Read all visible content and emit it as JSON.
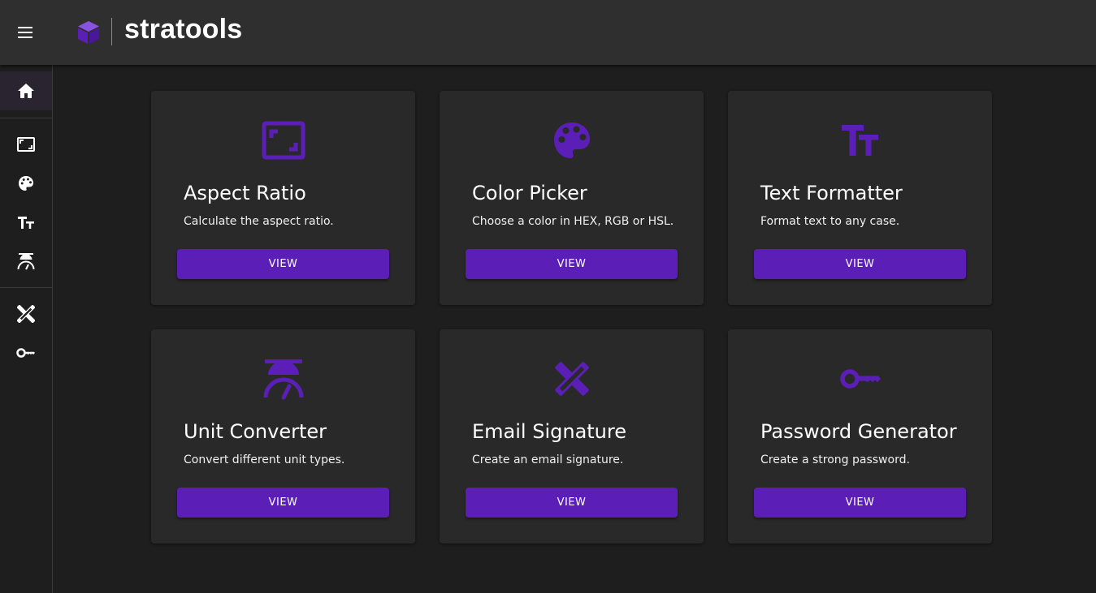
{
  "app": {
    "brand": "stratools",
    "accent_color": "#5b1fb7",
    "icon_color": "#5b1fb7"
  },
  "sidebar": {
    "items": [
      {
        "icon": "home-icon",
        "active": true
      },
      {
        "icon": "aspect-ratio-icon"
      },
      {
        "icon": "palette-icon"
      },
      {
        "icon": "text-fields-icon"
      },
      {
        "icon": "scale-icon"
      },
      {
        "icon": "design-services-icon"
      },
      {
        "icon": "key-icon"
      }
    ]
  },
  "cards": [
    {
      "icon": "aspect-ratio-icon",
      "title": "Aspect Ratio",
      "description": "Calculate the aspect ratio.",
      "button": "VIEW"
    },
    {
      "icon": "palette-icon",
      "title": "Color Picker",
      "description": "Choose a color in HEX, RGB or HSL.",
      "button": "VIEW"
    },
    {
      "icon": "text-fields-icon",
      "title": "Text Formatter",
      "description": "Format text to any case.",
      "button": "VIEW"
    },
    {
      "icon": "scale-icon",
      "title": "Unit Converter",
      "description": "Convert different unit types.",
      "button": "VIEW"
    },
    {
      "icon": "design-services-icon",
      "title": "Email Signature",
      "description": "Create an email signature.",
      "button": "VIEW"
    },
    {
      "icon": "key-icon",
      "title": "Password Generator",
      "description": "Create a strong password.",
      "button": "VIEW"
    }
  ]
}
